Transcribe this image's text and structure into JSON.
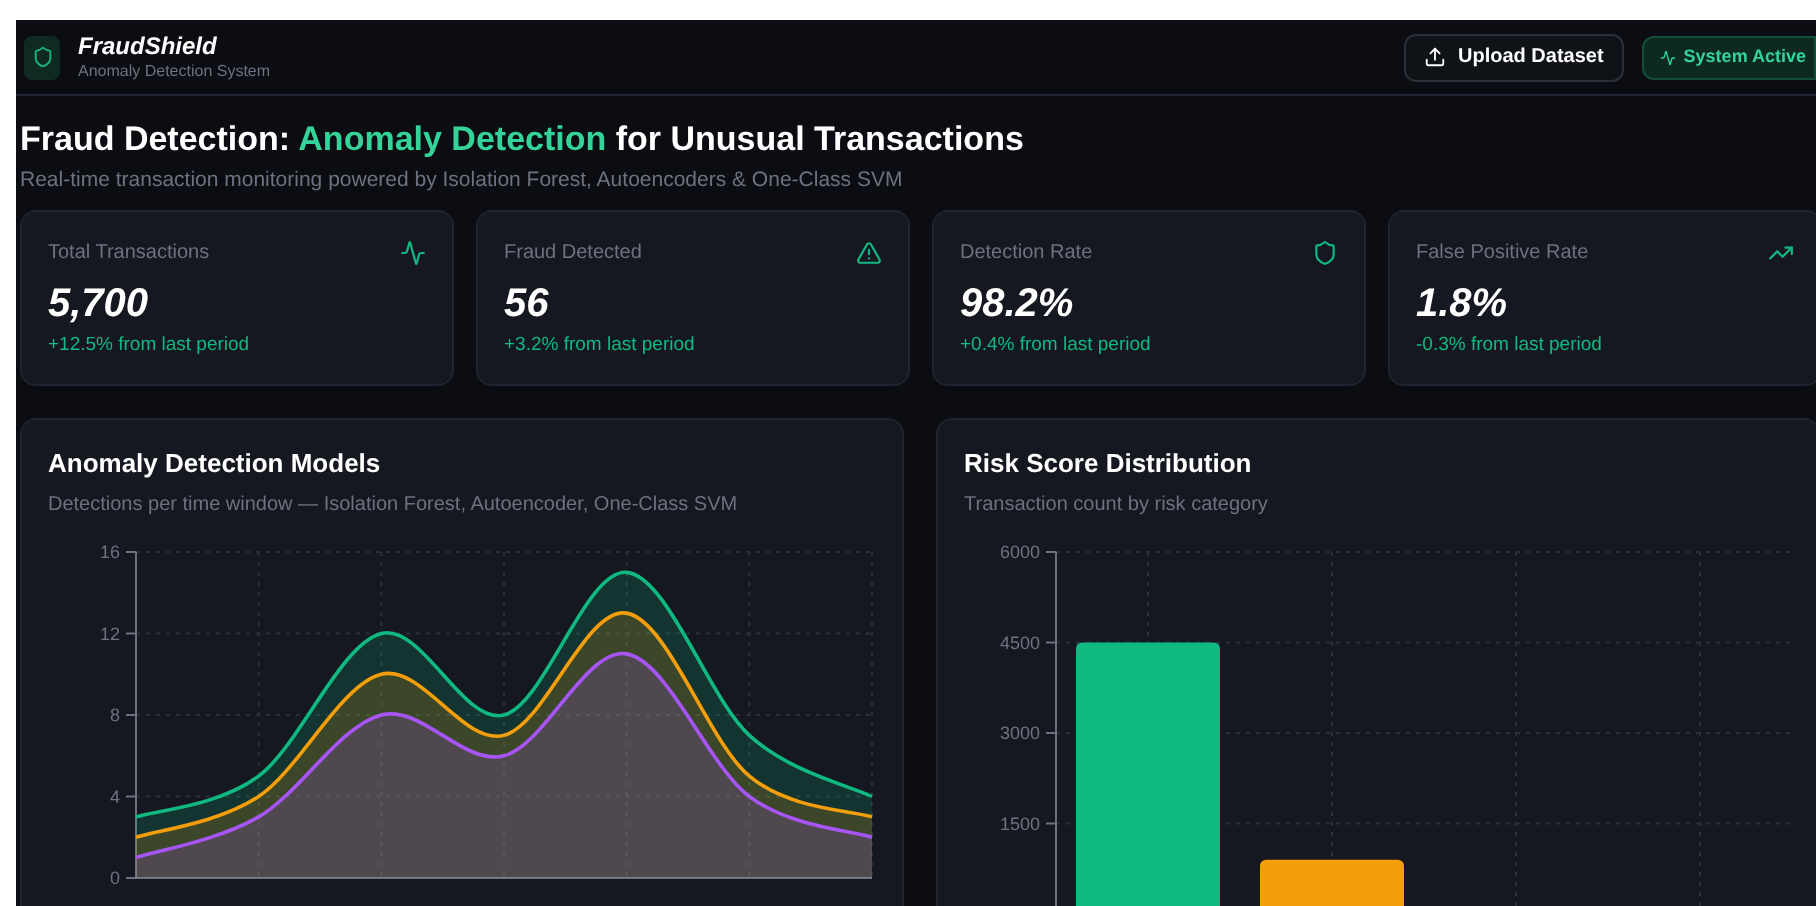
{
  "header": {
    "app_name": "FraudShield",
    "app_subtitle": "Anomaly Detection System",
    "upload_button": "Upload Dataset",
    "status_badge": "System Active"
  },
  "page": {
    "title_start": "Fraud Detection: ",
    "title_highlight": "Anomaly Detection",
    "title_end": " for Unusual Transactions",
    "subtitle": "Real-time transaction monitoring powered by Isolation Forest, Autoencoders & One-Class SVM"
  },
  "metrics": [
    {
      "kind": "activity",
      "label": "Total Transactions",
      "value": "5,700",
      "change": "+12.5% from last period"
    },
    {
      "kind": "alert",
      "label": "Fraud Detected",
      "value": "56",
      "change": "+3.2% from last period"
    },
    {
      "kind": "shield",
      "label": "Detection Rate",
      "value": "98.2%",
      "change": "+0.4% from last period"
    },
    {
      "kind": "trend",
      "label": "False Positive Rate",
      "value": "1.8%",
      "change": "-0.3% from last period"
    }
  ],
  "models_chart": {
    "title": "Anomaly Detection Models",
    "subtitle": "Detections per time window — Isolation Forest, Autoencoder, One-Class SVM",
    "chart_data": {
      "type": "area",
      "grid": true,
      "ylim": [
        0,
        16
      ],
      "yticks": [
        0,
        4,
        8,
        12,
        16
      ],
      "series": [
        {
          "color": "#10b981",
          "values": [
            3,
            5,
            12,
            8,
            15,
            7,
            4
          ]
        },
        {
          "color": "#f59e0b",
          "values": [
            2,
            4,
            10,
            7,
            13,
            5,
            3
          ]
        },
        {
          "color": "#a855f7",
          "values": [
            1,
            3,
            8,
            6,
            11,
            4,
            2
          ]
        }
      ]
    }
  },
  "risk_chart": {
    "title": "Risk Score Distribution",
    "subtitle": "Transaction count by risk category",
    "chart_data": {
      "type": "bar",
      "grid": true,
      "stacked": true,
      "ylim": [
        0,
        6000
      ],
      "yticks": [
        1500,
        3000,
        4500,
        6000
      ],
      "series": [
        {
          "color": "#10b981",
          "values": [
            4500,
            null
          ]
        },
        {
          "color": "#f59e0b",
          "values": [
            null,
            900
          ]
        }
      ]
    }
  }
}
